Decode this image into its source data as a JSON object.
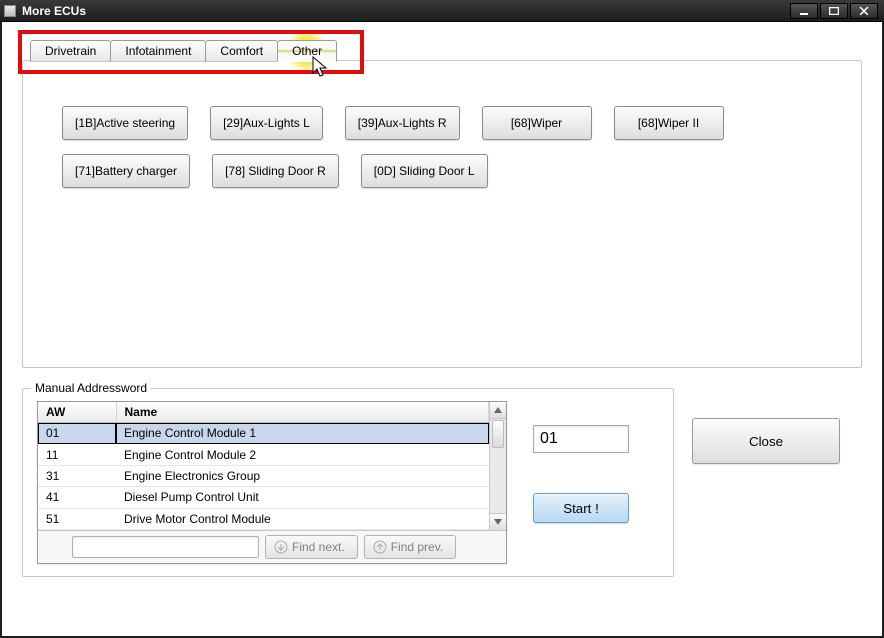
{
  "title": "More ECUs",
  "tabs": [
    "Drivetrain",
    "Infotainment",
    "Comfort",
    "Other"
  ],
  "active_tab": 3,
  "ecu_buttons": [
    "[1B]Active steering",
    "[29]Aux-Lights  L",
    "[39]Aux-Lights  R",
    "[68]Wiper",
    "[68]Wiper II",
    "[71]Battery charger",
    "[78] Sliding Door R",
    "[0D] Sliding Door L"
  ],
  "addressword": {
    "legend": "Manual Addressword",
    "cols": {
      "aw": "AW",
      "name": "Name"
    },
    "rows": [
      {
        "aw": "01",
        "name": "Engine Control Module 1"
      },
      {
        "aw": "11",
        "name": "Engine Control Module 2"
      },
      {
        "aw": "31",
        "name": "Engine Electronics Group"
      },
      {
        "aw": "41",
        "name": "Diesel Pump Control Unit"
      },
      {
        "aw": "51",
        "name": "Drive Motor Control Module"
      }
    ],
    "selected_index": 0,
    "input_value": "01",
    "find_next": "Find next.",
    "find_prev": "Find prev.",
    "search_value": ""
  },
  "start_label": "Start !",
  "close_label": "Close"
}
